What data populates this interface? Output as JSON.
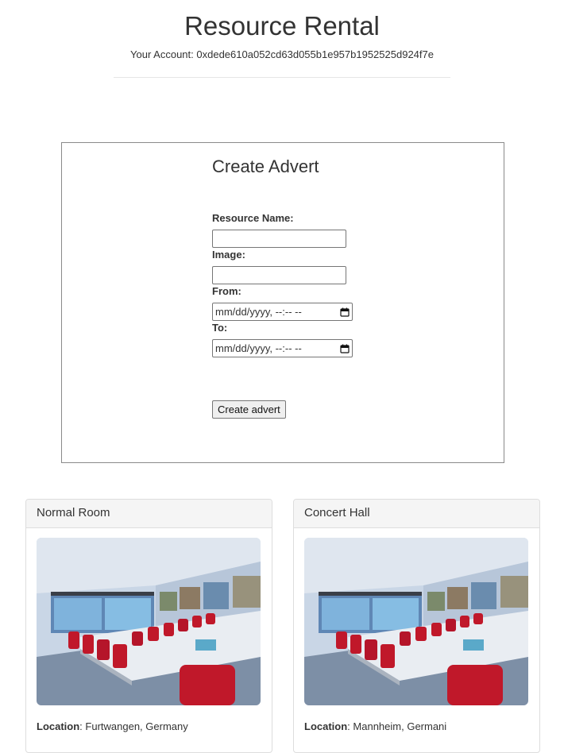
{
  "app": {
    "title": "Resource Rental",
    "account_label": "Your Account:",
    "account_address": "0xdede610a052cd63d055b1e957b1952525d924f7e"
  },
  "form": {
    "title": "Create Advert",
    "resource_name_label": "Resource Name:",
    "resource_name_value": "",
    "image_label": "Image:",
    "image_value": "",
    "from_label": "From:",
    "from_value": "mm/dd/yyyy, --:-- --",
    "to_label": "To:",
    "to_value": "mm/dd/yyyy, --:-- --",
    "submit_label": "Create advert"
  },
  "adverts": [
    {
      "name": "Normal Room",
      "location_label": "Location",
      "location": "Furtwangen, Germany"
    },
    {
      "name": "Concert Hall",
      "location_label": "Location",
      "location": "Mannheim, Germani"
    }
  ],
  "colors": {
    "text": "#333333",
    "border": "#8a8a8a",
    "card_heading_bg": "#f5f5f5",
    "chair_red": "#c0182a",
    "wall_blue": "#9db4cf"
  }
}
